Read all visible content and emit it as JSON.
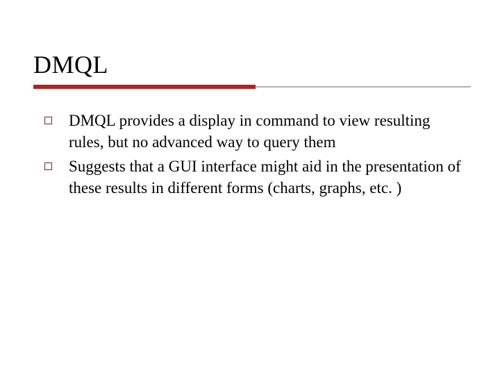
{
  "slide": {
    "title": "DMQL",
    "bullets": [
      "DMQL provides a display in command to view resulting rules, but no advanced way to query them",
      "Suggests that a GUI interface might aid in the presentation of these results in different forms (charts, graphs, etc. )"
    ]
  },
  "colors": {
    "accent": "#b22222",
    "bullet_border": "#8b1a1a",
    "underline_gray": "#b0b0b0"
  }
}
